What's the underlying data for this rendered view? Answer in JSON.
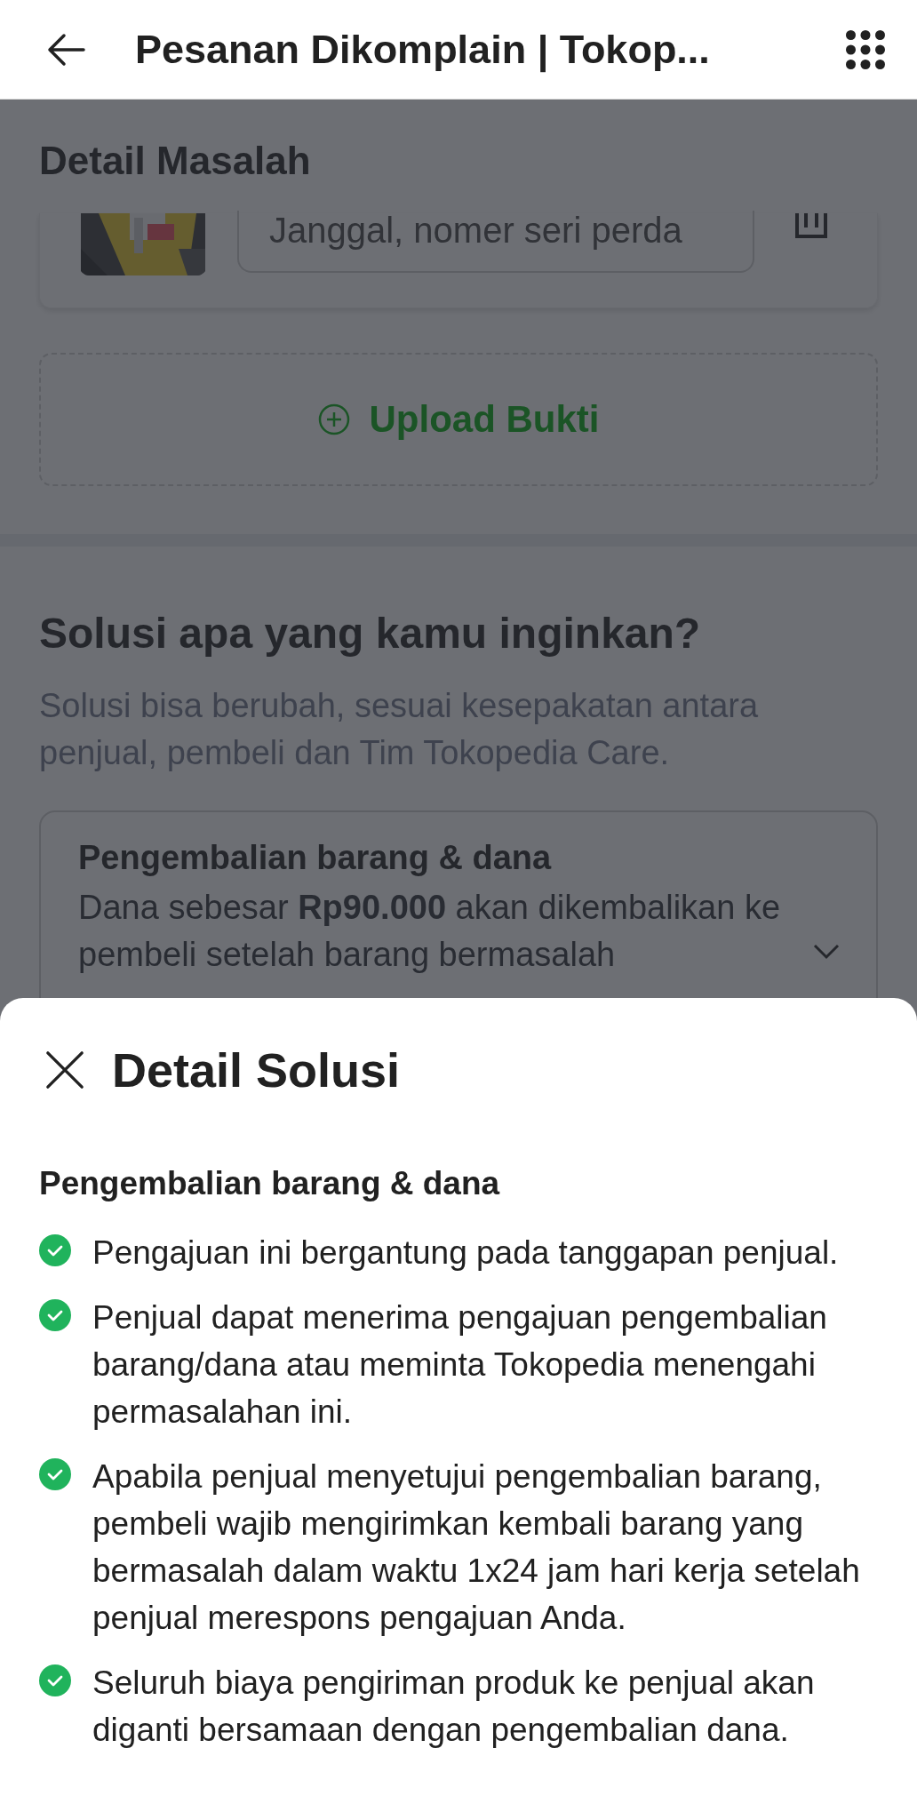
{
  "header": {
    "title": "Pesanan Dikomplain | Tokop..."
  },
  "problem_detail": {
    "title": "Detail Masalah",
    "evidence": [
      {
        "kind": "picture",
        "description": "Janggal, nomer seri perda"
      }
    ],
    "upload_button": "Upload Bukti"
  },
  "solution": {
    "title": "Solusi apa yang kamu inginkan?",
    "subtitle": "Solusi bisa berubah, sesuai kesepakatan antara penjual, pembeli dan Tim Tokopedia Care.",
    "option": {
      "title": "Pengembalian barang & dana",
      "description": "Dana sebesar **Rp90.000** akan dikembalikan ke pembeli setelah barang bermasalah",
      "expanded": false
    }
  },
  "sheet": {
    "title": "Detail Solusi",
    "heading": "Pengembalian barang & dana",
    "points": [
      "Pengajuan ini bergantung pada tanggapan penjual.",
      "Penjual dapat menerima pengajuan pengembalian barang/dana atau meminta Tokopedia menengahi permasalahan ini.",
      "Apabila penjual menyetujui pengembalian barang, pembeli wajib mengirimkan kembali barang yang bermasalah dalam waktu 1x24 jam hari kerja setelah penjual merespons pengajuan Anda.",
      "Seluruh biaya pengiriman produk ke penjual akan diganti bersamaan dengan pengembalian dana."
    ]
  }
}
